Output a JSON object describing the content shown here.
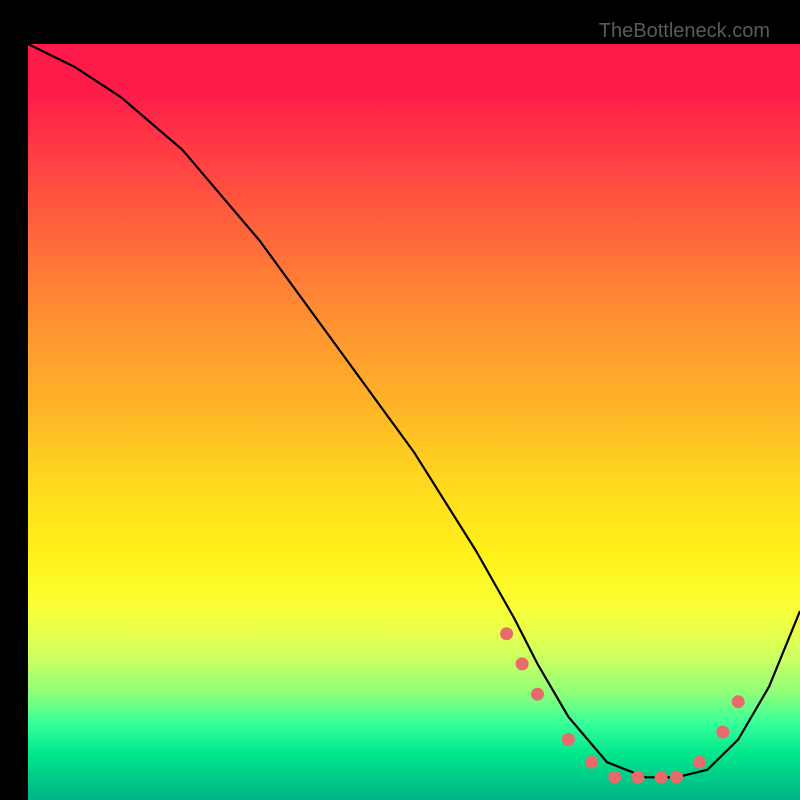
{
  "watermark": "TheBottleneck.com",
  "chart_data": {
    "type": "line",
    "title": "",
    "xlabel": "",
    "ylabel": "",
    "xlim": [
      0,
      100
    ],
    "ylim": [
      0,
      100
    ],
    "grid": false,
    "series": [
      {
        "name": "bottleneck-curve",
        "x": [
          0,
          6,
          12,
          20,
          30,
          40,
          50,
          58,
          63,
          66,
          70,
          75,
          80,
          84,
          88,
          92,
          96,
          100
        ],
        "y": [
          100,
          97,
          93,
          86,
          74,
          60,
          46,
          33,
          24,
          18,
          11,
          5,
          3,
          3,
          4,
          8,
          15,
          25
        ]
      }
    ],
    "markers": {
      "name": "highlight-points",
      "x": [
        62,
        64,
        66,
        70,
        73,
        76,
        79,
        82,
        84,
        87,
        90,
        92
      ],
      "y": [
        22,
        18,
        14,
        8,
        5,
        3,
        3,
        3,
        3,
        5,
        9,
        13
      ]
    },
    "background": "vertical-rainbow-gradient red-to-green"
  }
}
